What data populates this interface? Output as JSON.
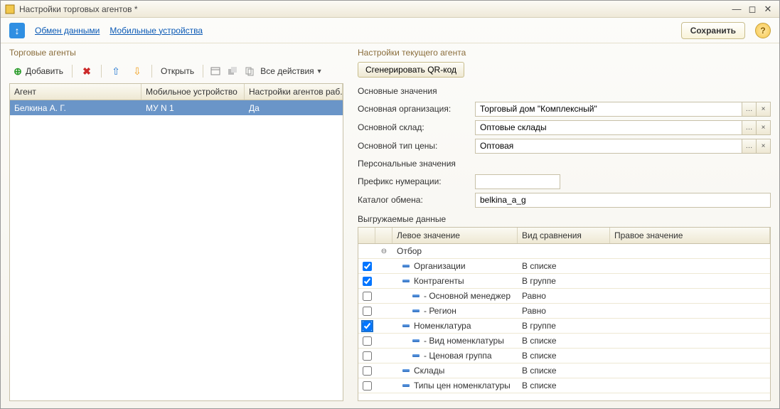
{
  "window": {
    "title": "Настройки торговых агентов *"
  },
  "toolbar": {
    "exchange_link": "Обмен данными",
    "mobile_link": "Мобильные устройства",
    "save_label": "Сохранить"
  },
  "left": {
    "header": "Торговые агенты",
    "add_label": "Добавить",
    "open_label": "Открыть",
    "all_actions_label": "Все действия",
    "columns": {
      "c1": "Агент",
      "c2": "Мобильное устройство",
      "c3": "Настройки агентов раб..."
    },
    "rows": [
      {
        "agent": "Белкина А. Г.",
        "device": "МУ N 1",
        "settings": "Да"
      }
    ]
  },
  "right": {
    "header": "Настройки текущего агента",
    "qr_label": "Сгенерировать QR-код",
    "group_main": "Основные значения",
    "org_label": "Основная организация:",
    "org_value": "Торговый дом \"Комплексный\"",
    "warehouse_label": "Основной склад:",
    "warehouse_value": "Оптовые склады",
    "price_label": "Основной тип цены:",
    "price_value": "Оптовая",
    "group_personal": "Персональные значения",
    "prefix_label": "Префикс нумерации:",
    "prefix_value": "",
    "catalog_label": "Каталог обмена:",
    "catalog_value": "belkina_a_g",
    "export_label": "Выгружаемые данные",
    "filter_columns": {
      "left": "Левое значение",
      "mid": "Вид сравнения",
      "right": "Правое значение"
    },
    "filter_root": "Отбор",
    "filter_rows": [
      {
        "checked": true,
        "indent": 0,
        "label": "Организации",
        "cmp": "В списке"
      },
      {
        "checked": true,
        "indent": 0,
        "label": "Контрагенты",
        "cmp": "В группе"
      },
      {
        "checked": false,
        "indent": 1,
        "label": "- Основной менеджер",
        "cmp": "Равно"
      },
      {
        "checked": false,
        "indent": 1,
        "label": "- Регион",
        "cmp": "Равно"
      },
      {
        "checked": true,
        "indent": 0,
        "label": "Номенклатура",
        "cmp": "В группе",
        "focus": true
      },
      {
        "checked": false,
        "indent": 1,
        "label": "- Вид номенклатуры",
        "cmp": "В списке"
      },
      {
        "checked": false,
        "indent": 1,
        "label": "- Ценовая группа",
        "cmp": "В списке"
      },
      {
        "checked": false,
        "indent": 0,
        "label": "Склады",
        "cmp": "В списке"
      },
      {
        "checked": false,
        "indent": 0,
        "label": "Типы цен номенклатуры",
        "cmp": "В списке"
      }
    ]
  }
}
